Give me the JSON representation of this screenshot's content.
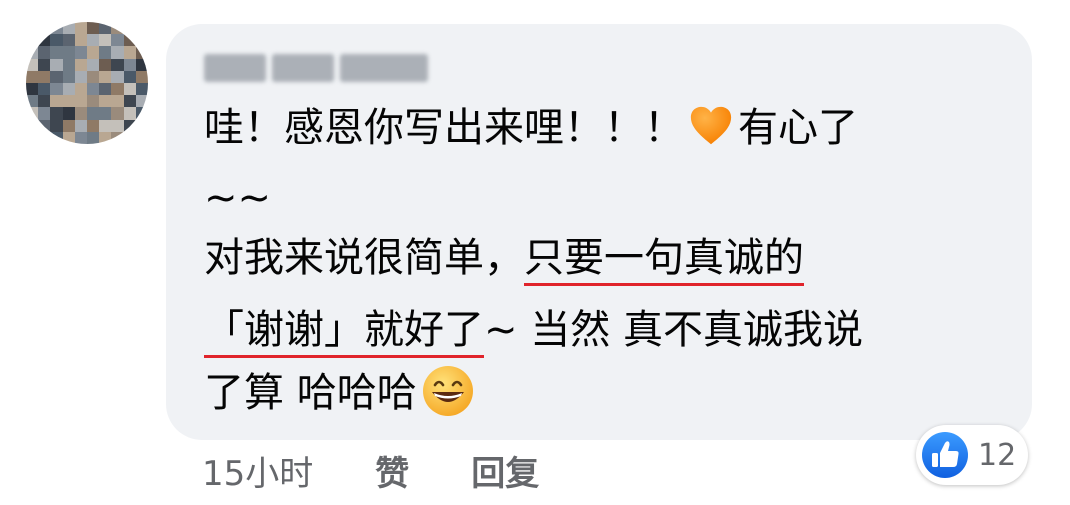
{
  "comment": {
    "line1_text": "哇！感恩你写出来哩！！！",
    "line1_after": "有心了",
    "line2": "~~",
    "line3_plain": "对我来说很简单，",
    "line3_underlined": "只要一句真诚的",
    "line4_underlined": "「谢谢」就好了",
    "line4_rest": "~ 当然 真不真诚我说",
    "line5": "了算 哈哈哈"
  },
  "footer": {
    "timestamp": "15小时",
    "like_label": "赞",
    "reply_label": "回复"
  },
  "reactions": {
    "count": "12",
    "type": "like"
  },
  "icons": {
    "avatar": "avatar-pixelated",
    "heart": "orange-heart-icon",
    "smile": "grinning-face-icon",
    "like": "thumbs-up-icon"
  },
  "colors": {
    "bubble": "#f0f2f5",
    "underline": "#e0242b",
    "like_blue": "#1877f2",
    "meta_gray": "#65676b"
  }
}
